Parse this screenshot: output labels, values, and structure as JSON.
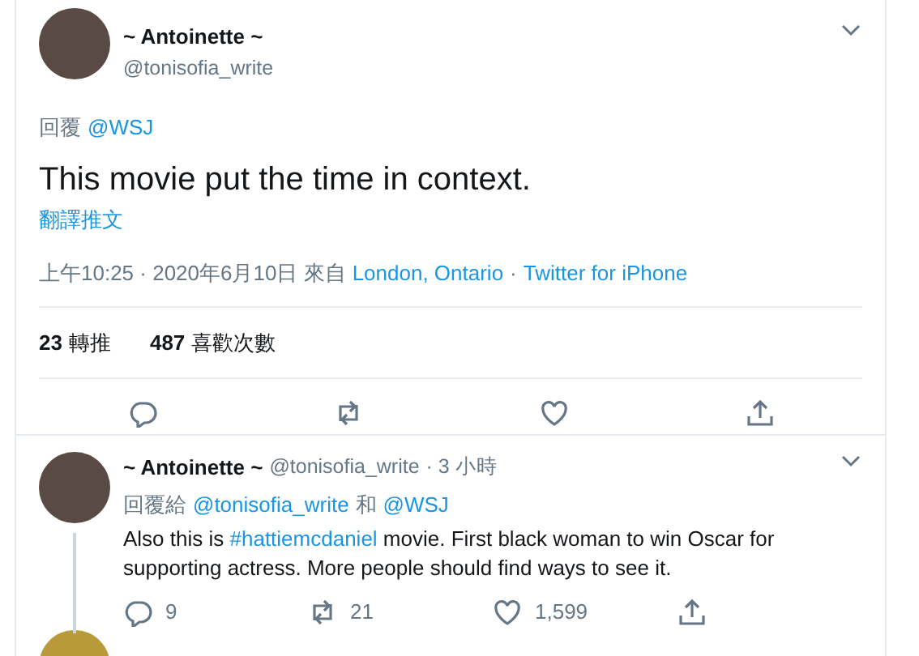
{
  "main_tweet": {
    "name": "~ Antoinette ~",
    "handle": "@tonisofia_write",
    "reply_label": "回覆",
    "reply_to": "@WSJ",
    "text": "This movie put the time in context.",
    "translate": "翻譯推文",
    "time": "上午10:25 · 2020年6月10日 來自",
    "location": "London, Ontario",
    "separator": "·",
    "source": "Twitter for iPhone",
    "stats": [
      {
        "count": "23",
        "label": "轉推"
      },
      {
        "count": "487",
        "label": "喜歡次數"
      }
    ]
  },
  "reply": {
    "name": "~ Antoinette ~",
    "handle": "@tonisofia_write",
    "age": "· 3 小時",
    "reply_label": "回覆給",
    "mentions": [
      "@tonisofia_write",
      "@WSJ"
    ],
    "joiner": "和",
    "text_before": "Also this is",
    "hashtag": "#hattiemcdaniel",
    "text_after": "movie. First black woman to win Oscar for supporting actress. More people should find ways to see it.",
    "actions": [
      {
        "kind": "reply",
        "count": "9"
      },
      {
        "kind": "retweet",
        "count": "21"
      },
      {
        "kind": "like",
        "count": "1,599"
      },
      {
        "kind": "share"
      }
    ]
  }
}
